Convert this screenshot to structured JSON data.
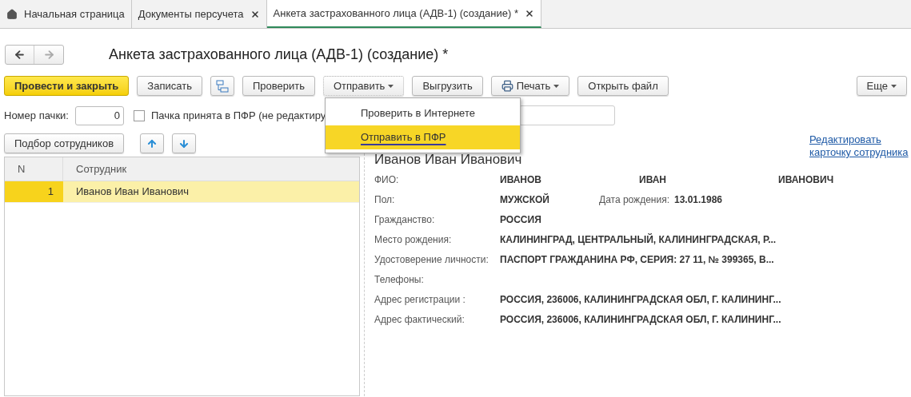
{
  "tabs": [
    {
      "kind": "home",
      "label": "Начальная страница",
      "closable": false,
      "selected": false
    },
    {
      "kind": "doc",
      "label": "Документы персучета",
      "closable": true,
      "selected": false
    },
    {
      "kind": "doc",
      "label": "Анкета застрахованного лица (АДВ-1) (создание) *",
      "closable": true,
      "selected": true
    }
  ],
  "title": "Анкета застрахованного лица (АДВ-1) (создание) *",
  "toolbar": [
    {
      "kind": "primary",
      "label": "Провести и закрыть"
    },
    {
      "kind": "plain",
      "label": "Записать"
    },
    {
      "kind": "structure"
    },
    {
      "kind": "plain",
      "label": "Проверить"
    },
    {
      "kind": "menu",
      "label": "Отправить",
      "open": true
    },
    {
      "kind": "plain",
      "label": "Выгрузить"
    },
    {
      "kind": "print",
      "label": "Печать"
    },
    {
      "kind": "plain",
      "label": "Открыть файл"
    }
  ],
  "more_button": "Еще",
  "send_menu": [
    {
      "label": "Проверить в Интернете",
      "selected": false
    },
    {
      "label": "Отправить в ПФР",
      "selected": true
    }
  ],
  "batch": {
    "label": "Номер пачки:",
    "value": "0",
    "accepted_label": "Пачка принята в ПФР (не редактиру",
    "accepted": false
  },
  "pick_button": "Подбор сотрудников",
  "table": {
    "columns": [
      "N",
      "Сотрудник"
    ],
    "rows": [
      {
        "n": "1",
        "name": "Иванов Иван Иванович",
        "selected": true
      }
    ]
  },
  "details": {
    "name": "Иванов Иван Иванович",
    "edit_link": "Редактировать карточку сотрудника",
    "fields": [
      {
        "kind": "fio",
        "label": "ФИО:",
        "values": [
          "ИВАНОВ",
          "ИВАН",
          "ИВАНОВИЧ"
        ]
      },
      {
        "kind": "sex",
        "label": "Пол:",
        "values": [
          "МУЖСКОЙ"
        ],
        "extra_label": "Дата рождения:",
        "extra_value": "13.01.1986"
      },
      {
        "kind": "text",
        "label": "Гражданство:",
        "values": [
          "РОССИЯ"
        ]
      },
      {
        "kind": "text",
        "label": "Место рождения:",
        "values": [
          "КАЛИНИНГРАД, ЦЕНТРАЛЬНЫЙ, КАЛИНИНГРАДСКАЯ, Р..."
        ]
      },
      {
        "kind": "text",
        "label": "Удостоверение личности:",
        "values": [
          "ПАСПОРТ ГРАЖДАНИНА РФ, СЕРИЯ: 27 11, № 399365, В..."
        ]
      },
      {
        "kind": "text",
        "label": "Телефоны:"
      },
      {
        "kind": "text",
        "label": "Адрес регистрации :",
        "values": [
          "РОССИЯ, 236006, КАЛИНИНГРАДСКАЯ ОБЛ, Г. КАЛИНИНГ..."
        ]
      },
      {
        "kind": "text",
        "label": "Адрес фактический:",
        "values": [
          "РОССИЯ, 236006, КАЛИНИНГРАДСКАЯ ОБЛ, Г. КАЛИНИНГ..."
        ]
      }
    ]
  }
}
